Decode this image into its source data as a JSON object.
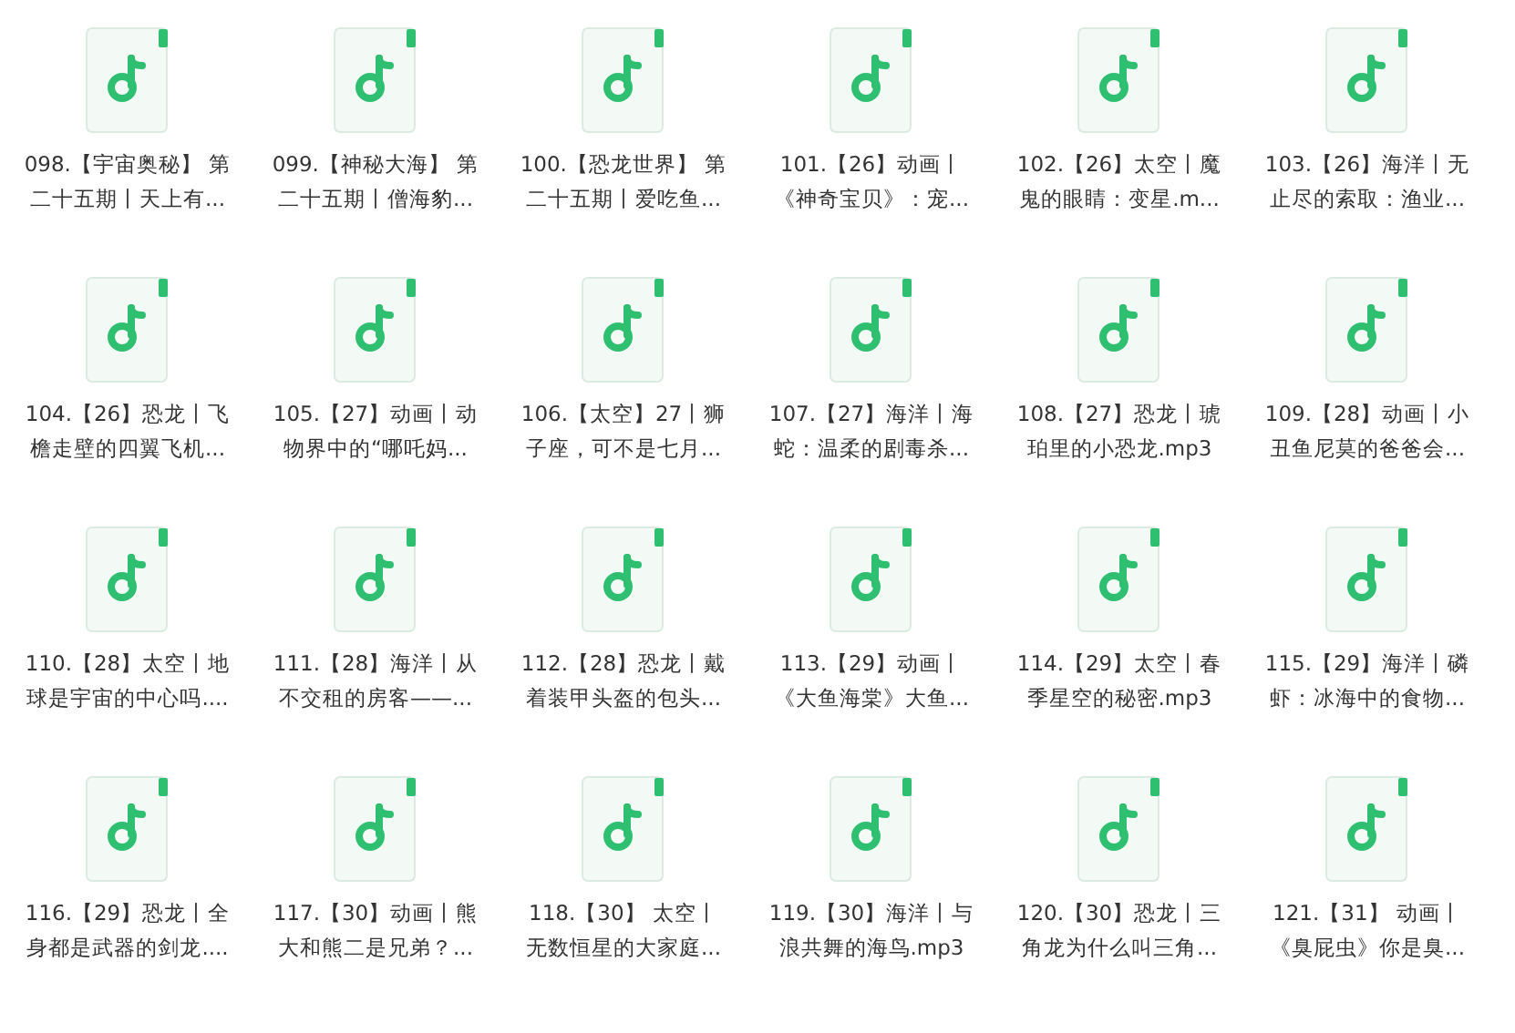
{
  "files": [
    {
      "lines": [
        "098.【宇宙奥秘】 第",
        "二十五期丨天上有..."
      ]
    },
    {
      "lines": [
        "099.【神秘大海】 第",
        "二十五期丨僧海豹..."
      ]
    },
    {
      "lines": [
        "100.【恐龙世界】 第",
        "二十五期丨爱吃鱼..."
      ]
    },
    {
      "lines": [
        "101.【26】动画丨",
        "《神奇宝贝》：宠..."
      ]
    },
    {
      "lines": [
        "102.【26】太空丨魔",
        "鬼的眼睛：变星.m..."
      ]
    },
    {
      "lines": [
        "103.【26】海洋丨无",
        "止尽的索取：渔业..."
      ]
    },
    {
      "lines": [
        "104.【26】恐龙丨飞",
        "檐走壁的四翼飞机..."
      ]
    },
    {
      "lines": [
        "105.【27】动画丨动",
        "物界中的“哪吒妈..."
      ]
    },
    {
      "lines": [
        "106.【太空】27丨狮",
        "子座，可不是七月..."
      ]
    },
    {
      "lines": [
        "107.【27】海洋丨海",
        "蛇：温柔的剧毒杀..."
      ]
    },
    {
      "lines": [
        "108.【27】恐龙丨琥",
        "珀里的小恐龙.mp3"
      ]
    },
    {
      "lines": [
        "109.【28】动画丨小",
        "丑鱼尼莫的爸爸会..."
      ]
    },
    {
      "lines": [
        "110.【28】太空丨地",
        "球是宇宙的中心吗...."
      ]
    },
    {
      "lines": [
        "111.【28】海洋丨从",
        "不交租的房客——..."
      ]
    },
    {
      "lines": [
        "112.【28】恐龙丨戴",
        "着装甲头盔的包头..."
      ]
    },
    {
      "lines": [
        "113.【29】动画丨",
        "《大鱼海棠》大鱼..."
      ]
    },
    {
      "lines": [
        "114.【29】太空丨春",
        "季星空的秘密.mp3"
      ]
    },
    {
      "lines": [
        "115.【29】海洋丨磷",
        "虾：冰海中的食物..."
      ]
    },
    {
      "lines": [
        "116.【29】恐龙丨全",
        "身都是武器的剑龙...."
      ]
    },
    {
      "lines": [
        "117.【30】动画丨熊",
        "大和熊二是兄弟？..."
      ]
    },
    {
      "lines": [
        "118.【30】 太空丨",
        "无数恒星的大家庭..."
      ]
    },
    {
      "lines": [
        "119.【30】海洋丨与",
        "浪共舞的海鸟.mp3"
      ]
    },
    {
      "lines": [
        "120.【30】恐龙丨三",
        "角龙为什么叫三角..."
      ]
    },
    {
      "lines": [
        "121.【31】 动画丨",
        "《臭屁虫》你是臭..."
      ]
    }
  ]
}
